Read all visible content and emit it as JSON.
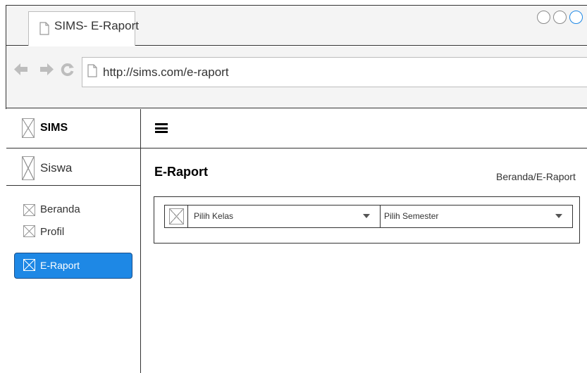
{
  "browser": {
    "tab_title": "SIMS- E-Raport",
    "url": "http://sims.com/e-raport"
  },
  "sidebar": {
    "brand": "SIMS",
    "user_label": "Siswa",
    "items": [
      {
        "label": "Beranda",
        "active": false
      },
      {
        "label": "Profil",
        "active": false
      },
      {
        "label": "E-Raport",
        "active": true
      }
    ]
  },
  "main": {
    "title": "E-Raport",
    "breadcrumb": "Beranda/E-Raport",
    "filters": {
      "kelas_selected": "Pilih Kelas",
      "semester_selected": "Pilih Semester"
    }
  },
  "colors": {
    "accent": "#1e88e5",
    "chrome_bg": "#f4f4f4",
    "window_control_active": "#1e88e5"
  },
  "icons": {
    "tab": "document-icon",
    "nav_back": "arrow-left-icon",
    "nav_forward": "arrow-right-icon",
    "reload": "reload-icon",
    "menu": "hamburger-menu-icon",
    "placeholder": "image-placeholder-icon"
  }
}
